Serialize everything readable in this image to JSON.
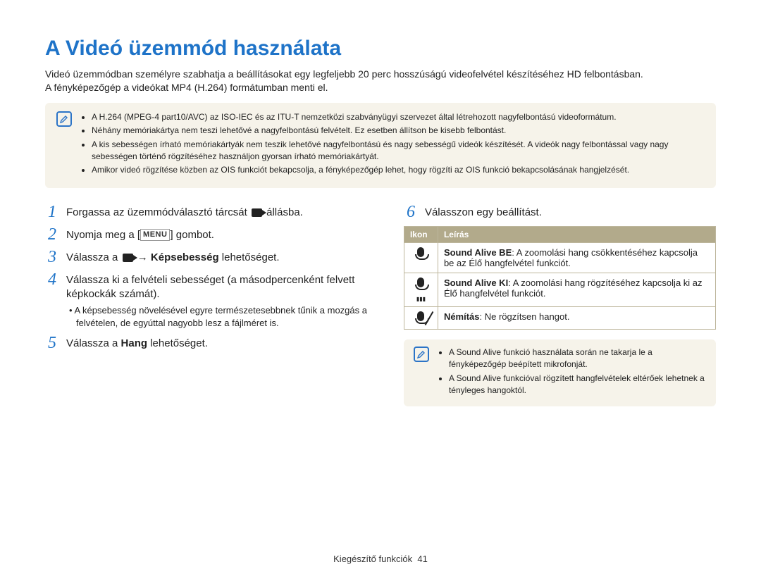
{
  "title": "A Videó üzemmód használata",
  "intro_line1": "Videó üzemmódban személyre szabhatja a beállításokat egy legfeljebb 20 perc hosszúságú videofelvétel készítéséhez HD felbontásban.",
  "intro_line2": "A fényképezőgép a videókat MP4 (H.264) formátumban menti el.",
  "note_items": [
    "A H.264 (MPEG-4 part10/AVC) az ISO-IEC és az ITU-T nemzetközi szabványügyi szervezet által létrehozott nagyfelbontású videoformátum.",
    "Néhány memóriakártya nem teszi lehetővé a nagyfelbontású felvételt. Ez esetben állítson be kisebb felbontást.",
    "A kis sebességen írható memóriakártyák nem teszik lehetővé nagyfelbontású és nagy sebességű videók készítését. A videók nagy felbontással vagy nagy sebességen történő rögzítéséhez használjon gyorsan írható memóriakártyát.",
    "Amikor videó rögzítése közben az OIS funkciót bekapcsolja, a fényképezőgép lehet, hogy rögzíti az OIS funkció bekapcsolásának hangjelzését."
  ],
  "steps": {
    "s1_prefix": "Forgassa az üzemmódválasztó tárcsát ",
    "s1_suffix": " állásba.",
    "s2_prefix": "Nyomja meg a [",
    "s2_menu": "MENU",
    "s2_suffix": "] gombot.",
    "s3_prefix": "Válassza a ",
    "s3_arrow": " → ",
    "s3_bold": "Képsebesség",
    "s3_suffix": " lehetőséget.",
    "s4": "Válassza ki a felvételi sebességet (a másodpercenként felvett képkockák számát).",
    "s4_sub": "A képsebesség növelésével egyre természetesebbnek tűnik a mozgás a felvételen, de egyúttal nagyobb lesz a fájlméret is.",
    "s5_prefix": "Válassza a ",
    "s5_bold": "Hang",
    "s5_suffix": " lehetőséget.",
    "s6": "Válasszon egy beállítást."
  },
  "table": {
    "head_icon": "Ikon",
    "head_desc": "Leírás",
    "row1_title": "Sound Alive BE",
    "row1_text": ": A zoomolási hang csökkentéséhez kapcsolja be az Élő hangfelvétel funkciót.",
    "row2_title": "Sound Alive KI",
    "row2_text": ": A zoomolási hang rögzítéséhez kapcsolja ki az Élő hangfelvétel funkciót.",
    "row3_title": "Némítás",
    "row3_text": ": Ne rögzítsen hangot."
  },
  "note2_items": [
    "A Sound Alive funkció használata során ne takarja le a fényképezőgép beépített mikrofonját.",
    "A Sound Alive funkcióval rögzített hangfelvételek eltérőek lehetnek a tényleges hangoktól."
  ],
  "footer_section": "Kiegészítő funkciók",
  "footer_page": "41"
}
